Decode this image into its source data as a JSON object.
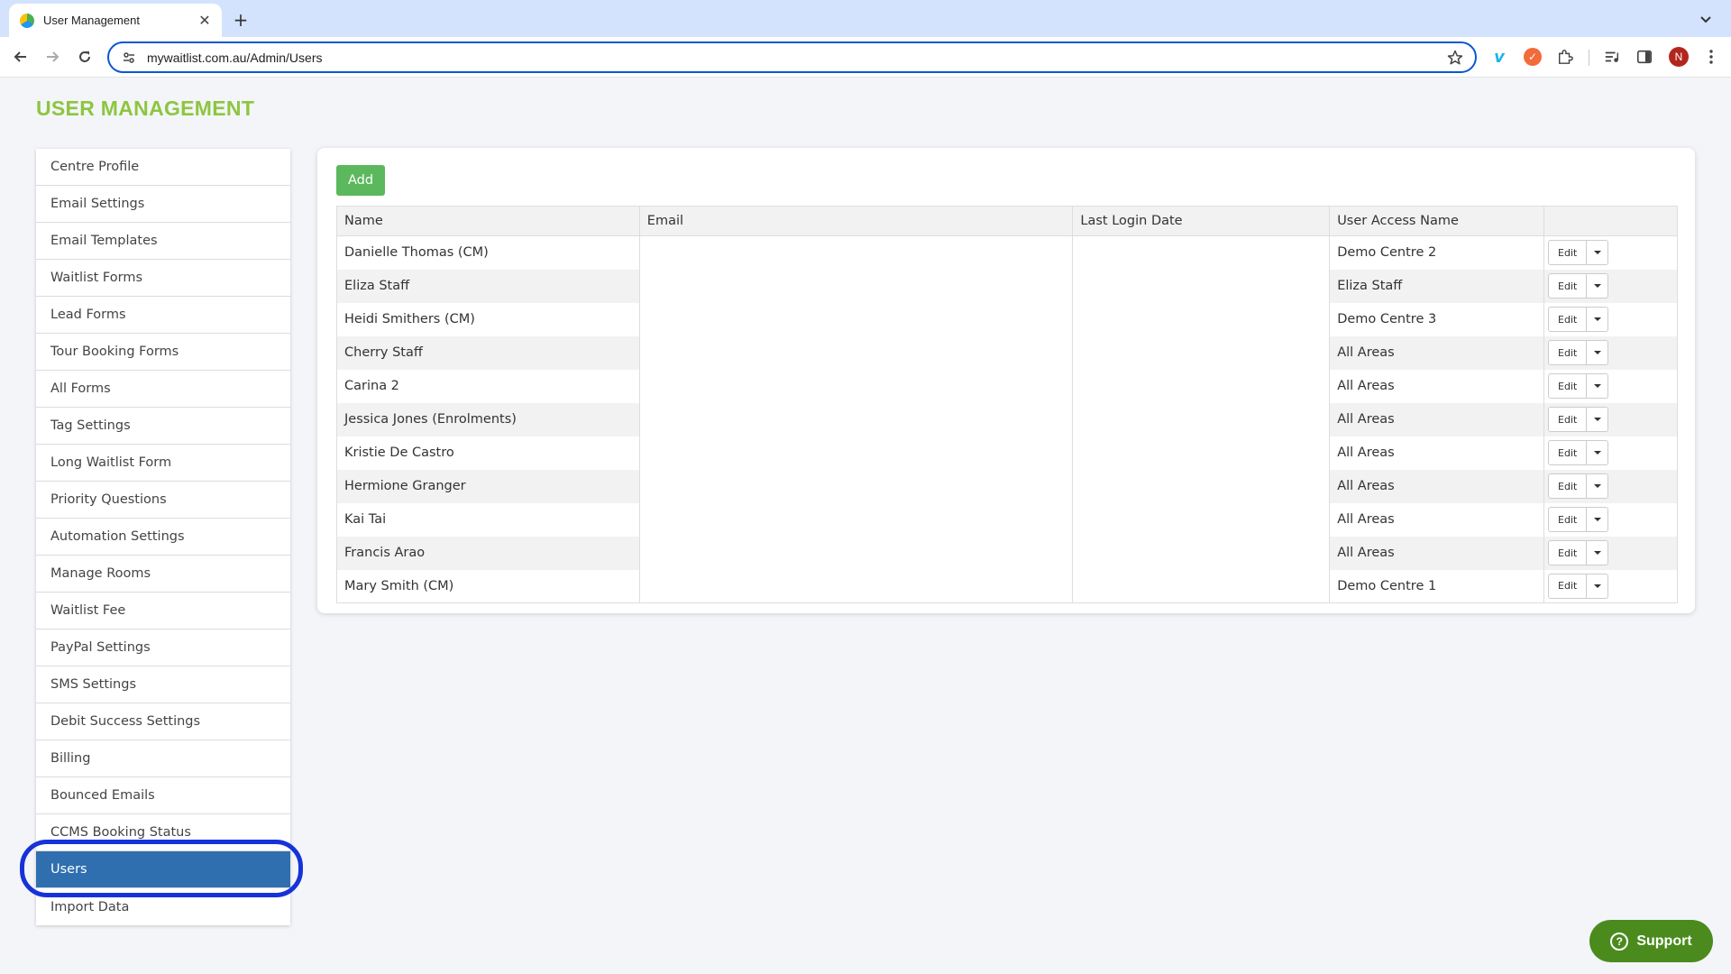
{
  "browser": {
    "tab_title": "User Management",
    "tab_close": "✕",
    "new_tab": "+",
    "url": "mywaitlist.com.au/Admin/Users",
    "profile_initial": "N"
  },
  "page": {
    "title": "USER MANAGEMENT"
  },
  "sidebar": {
    "items": [
      {
        "label": "Centre Profile"
      },
      {
        "label": "Email Settings"
      },
      {
        "label": "Email Templates"
      },
      {
        "label": "Waitlist Forms"
      },
      {
        "label": "Lead Forms"
      },
      {
        "label": "Tour Booking Forms"
      },
      {
        "label": "All Forms"
      },
      {
        "label": "Tag Settings"
      },
      {
        "label": "Long Waitlist Form"
      },
      {
        "label": "Priority Questions"
      },
      {
        "label": "Automation Settings"
      },
      {
        "label": "Manage Rooms"
      },
      {
        "label": "Waitlist Fee"
      },
      {
        "label": "PayPal Settings"
      },
      {
        "label": "SMS Settings"
      },
      {
        "label": "Debit Success Settings"
      },
      {
        "label": "Billing"
      },
      {
        "label": "Bounced Emails"
      },
      {
        "label": "CCMS Booking Status"
      },
      {
        "label": "Users"
      },
      {
        "label": "Import Data"
      }
    ],
    "active": "Users"
  },
  "toolbar": {
    "add_label": "Add"
  },
  "table": {
    "headers": [
      "Name",
      "Email",
      "Last Login Date",
      "User Access Name",
      ""
    ],
    "rows": [
      {
        "name": "Danielle Thomas (CM)",
        "email": "",
        "last_login": "",
        "access": "Demo Centre 2",
        "edit": "Edit"
      },
      {
        "name": "Eliza Staff",
        "email": "",
        "last_login": "",
        "access": "Eliza Staff",
        "edit": "Edit"
      },
      {
        "name": "Heidi Smithers (CM)",
        "email": "",
        "last_login": "",
        "access": "Demo Centre 3",
        "edit": "Edit"
      },
      {
        "name": "Cherry Staff",
        "email": "",
        "last_login": "",
        "access": "All Areas",
        "edit": "Edit"
      },
      {
        "name": "Carina 2",
        "email": "",
        "last_login": "",
        "access": "All Areas",
        "edit": "Edit"
      },
      {
        "name": "Jessica Jones (Enrolments)",
        "email": "",
        "last_login": "",
        "access": "All Areas",
        "edit": "Edit"
      },
      {
        "name": "Kristie De Castro",
        "email": "",
        "last_login": "",
        "access": "All Areas",
        "edit": "Edit"
      },
      {
        "name": "Hermione Granger",
        "email": "",
        "last_login": "",
        "access": "All Areas",
        "edit": "Edit"
      },
      {
        "name": "Kai Tai",
        "email": "",
        "last_login": "",
        "access": "All Areas",
        "edit": "Edit"
      },
      {
        "name": "Francis Arao",
        "email": "",
        "last_login": "",
        "access": "All Areas",
        "edit": "Edit"
      },
      {
        "name": "Mary Smith (CM)",
        "email": "",
        "last_login": "",
        "access": "Demo Centre 1",
        "edit": "Edit"
      }
    ]
  },
  "support": {
    "label": "Support",
    "icon": "?"
  },
  "colors": {
    "title_green": "#8dc63f",
    "add_green": "#5cb85c",
    "active_blue": "#2f6fb0",
    "ring_blue": "#1633d9",
    "support_green": "#4b8b1d"
  }
}
